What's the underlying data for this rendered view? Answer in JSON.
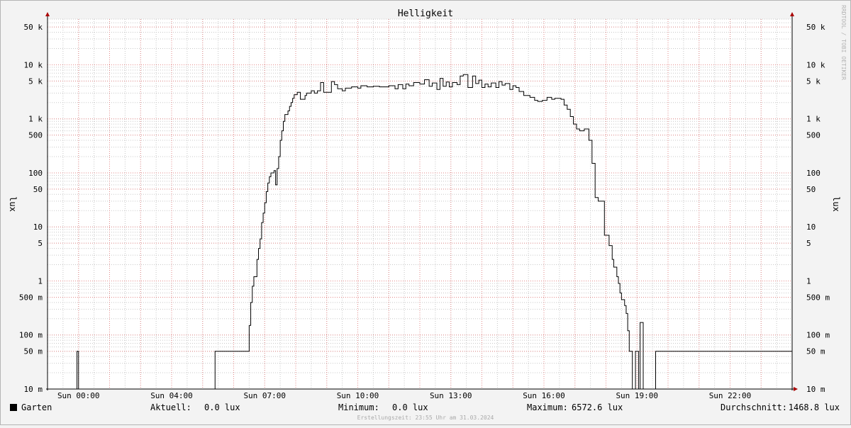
{
  "chart_data": {
    "type": "line",
    "title": "Helligkeit",
    "ylabel": "lux",
    "ylabel_right": "lux",
    "watermark": "RRDTOOL / TOBI OETIKER",
    "yscale": "log",
    "ylim": [
      0.01,
      70000
    ],
    "yticks": [
      {
        "value": 0.01,
        "label": "10 m"
      },
      {
        "value": 0.05,
        "label": "50 m"
      },
      {
        "value": 0.1,
        "label": "100 m"
      },
      {
        "value": 0.5,
        "label": "500 m"
      },
      {
        "value": 1,
        "label": "1"
      },
      {
        "value": 5,
        "label": "5"
      },
      {
        "value": 10,
        "label": "10"
      },
      {
        "value": 50,
        "label": "50"
      },
      {
        "value": 100,
        "label": "100"
      },
      {
        "value": 500,
        "label": "500"
      },
      {
        "value": 1000,
        "label": "1 k"
      },
      {
        "value": 5000,
        "label": "5 k"
      },
      {
        "value": 10000,
        "label": "10 k"
      },
      {
        "value": 50000,
        "label": "50 k"
      }
    ],
    "xunit": "hours of Sun 31.03.2024",
    "xlim": [
      -1,
      23.0
    ],
    "xticks": [
      {
        "value": 0,
        "label": "Sun 00:00"
      },
      {
        "value": 3,
        "label": "Sun 04:00"
      },
      {
        "value": 6,
        "label": "Sun 07:00"
      },
      {
        "value": 9,
        "label": "Sun 10:00"
      },
      {
        "value": 12,
        "label": "Sun 13:00"
      },
      {
        "value": 15,
        "label": "Sun 16:00"
      },
      {
        "value": 18,
        "label": "Sun 19:00"
      },
      {
        "value": 21,
        "label": "Sun 22:00"
      }
    ],
    "series": [
      {
        "name": "Garten",
        "color": "#000000",
        "points": [
          [
            -1.0,
            0.01
          ],
          [
            -0.05,
            0.01
          ],
          [
            -0.05,
            0.05
          ],
          [
            0.0,
            0.05
          ],
          [
            0.0,
            0.01
          ],
          [
            4.4,
            0.01
          ],
          [
            4.4,
            0.05
          ],
          [
            5.5,
            0.05
          ],
          [
            5.5,
            0.15
          ],
          [
            5.55,
            0.15
          ],
          [
            5.55,
            0.4
          ],
          [
            5.6,
            0.4
          ],
          [
            5.6,
            0.8
          ],
          [
            5.65,
            0.8
          ],
          [
            5.65,
            1.2
          ],
          [
            5.75,
            1.2
          ],
          [
            5.75,
            2.5
          ],
          [
            5.8,
            2.5
          ],
          [
            5.8,
            4
          ],
          [
            5.85,
            4
          ],
          [
            5.85,
            6
          ],
          [
            5.9,
            6
          ],
          [
            5.9,
            12
          ],
          [
            5.95,
            12
          ],
          [
            5.95,
            18
          ],
          [
            6.0,
            18
          ],
          [
            6.0,
            28
          ],
          [
            6.05,
            28
          ],
          [
            6.05,
            45
          ],
          [
            6.1,
            45
          ],
          [
            6.1,
            65
          ],
          [
            6.15,
            65
          ],
          [
            6.15,
            85
          ],
          [
            6.2,
            85
          ],
          [
            6.2,
            100
          ],
          [
            6.3,
            100
          ],
          [
            6.3,
            110
          ],
          [
            6.35,
            110
          ],
          [
            6.35,
            60
          ],
          [
            6.4,
            60
          ],
          [
            6.4,
            120
          ],
          [
            6.45,
            120
          ],
          [
            6.45,
            200
          ],
          [
            6.5,
            200
          ],
          [
            6.5,
            400
          ],
          [
            6.55,
            400
          ],
          [
            6.55,
            600
          ],
          [
            6.6,
            600
          ],
          [
            6.6,
            900
          ],
          [
            6.65,
            900
          ],
          [
            6.65,
            1200
          ],
          [
            6.75,
            1200
          ],
          [
            6.75,
            1400
          ],
          [
            6.8,
            1400
          ],
          [
            6.8,
            1700
          ],
          [
            6.85,
            1700
          ],
          [
            6.85,
            2000
          ],
          [
            6.9,
            2000
          ],
          [
            6.9,
            2400
          ],
          [
            6.95,
            2400
          ],
          [
            6.95,
            2800
          ],
          [
            7.05,
            2800
          ],
          [
            7.05,
            3100
          ],
          [
            7.15,
            3100
          ],
          [
            7.15,
            2300
          ],
          [
            7.3,
            2300
          ],
          [
            7.3,
            2700
          ],
          [
            7.35,
            2700
          ],
          [
            7.35,
            3000
          ],
          [
            7.5,
            3000
          ],
          [
            7.5,
            3300
          ],
          [
            7.6,
            3300
          ],
          [
            7.6,
            3000
          ],
          [
            7.7,
            3000
          ],
          [
            7.7,
            3300
          ],
          [
            7.8,
            3300
          ],
          [
            7.8,
            4700
          ],
          [
            7.9,
            4700
          ],
          [
            7.9,
            3100
          ],
          [
            8.15,
            3100
          ],
          [
            8.15,
            4900
          ],
          [
            8.25,
            4900
          ],
          [
            8.25,
            4300
          ],
          [
            8.35,
            4300
          ],
          [
            8.35,
            3600
          ],
          [
            8.5,
            3600
          ],
          [
            8.5,
            3300
          ],
          [
            8.6,
            3300
          ],
          [
            8.6,
            3700
          ],
          [
            8.8,
            3700
          ],
          [
            8.8,
            3900
          ],
          [
            9.0,
            3900
          ],
          [
            9.0,
            3700
          ],
          [
            9.1,
            3700
          ],
          [
            9.1,
            4100
          ],
          [
            9.3,
            4100
          ],
          [
            9.3,
            3900
          ],
          [
            9.5,
            3900
          ],
          [
            9.5,
            4000
          ],
          [
            9.7,
            4000
          ],
          [
            9.7,
            3900
          ],
          [
            10.0,
            3900
          ],
          [
            10.0,
            4100
          ],
          [
            10.2,
            4100
          ],
          [
            10.2,
            3600
          ],
          [
            10.3,
            3600
          ],
          [
            10.3,
            4300
          ],
          [
            10.45,
            4300
          ],
          [
            10.45,
            3600
          ],
          [
            10.55,
            3600
          ],
          [
            10.55,
            4400
          ],
          [
            10.65,
            4400
          ],
          [
            10.65,
            4100
          ],
          [
            10.8,
            4100
          ],
          [
            10.8,
            4700
          ],
          [
            11.0,
            4700
          ],
          [
            11.0,
            4400
          ],
          [
            11.15,
            4400
          ],
          [
            11.15,
            5300
          ],
          [
            11.3,
            5300
          ],
          [
            11.3,
            4000
          ],
          [
            11.4,
            4000
          ],
          [
            11.4,
            4600
          ],
          [
            11.55,
            4600
          ],
          [
            11.55,
            3500
          ],
          [
            11.65,
            3500
          ],
          [
            11.65,
            5600
          ],
          [
            11.75,
            5600
          ],
          [
            11.75,
            4000
          ],
          [
            11.85,
            4000
          ],
          [
            11.85,
            4800
          ],
          [
            11.95,
            4800
          ],
          [
            11.95,
            3900
          ],
          [
            12.05,
            3900
          ],
          [
            12.05,
            4700
          ],
          [
            12.2,
            4700
          ],
          [
            12.2,
            4300
          ],
          [
            12.3,
            4300
          ],
          [
            12.3,
            6200
          ],
          [
            12.4,
            6200
          ],
          [
            12.4,
            6600
          ],
          [
            12.55,
            6600
          ],
          [
            12.55,
            3800
          ],
          [
            12.7,
            3800
          ],
          [
            12.7,
            6200
          ],
          [
            12.8,
            6200
          ],
          [
            12.8,
            4500
          ],
          [
            12.9,
            4500
          ],
          [
            12.9,
            5200
          ],
          [
            13.0,
            5200
          ],
          [
            13.0,
            3800
          ],
          [
            13.1,
            3800
          ],
          [
            13.1,
            4400
          ],
          [
            13.2,
            4400
          ],
          [
            13.2,
            3900
          ],
          [
            13.3,
            3900
          ],
          [
            13.3,
            4600
          ],
          [
            13.45,
            4600
          ],
          [
            13.45,
            3800
          ],
          [
            13.55,
            3800
          ],
          [
            13.55,
            4900
          ],
          [
            13.65,
            4900
          ],
          [
            13.65,
            4200
          ],
          [
            13.75,
            4200
          ],
          [
            13.75,
            4500
          ],
          [
            13.9,
            4500
          ],
          [
            13.9,
            3500
          ],
          [
            14.0,
            3500
          ],
          [
            14.0,
            4100
          ],
          [
            14.1,
            4100
          ],
          [
            14.1,
            3800
          ],
          [
            14.2,
            3800
          ],
          [
            14.2,
            3200
          ],
          [
            14.35,
            3200
          ],
          [
            14.35,
            2700
          ],
          [
            14.55,
            2700
          ],
          [
            14.55,
            2500
          ],
          [
            14.7,
            2500
          ],
          [
            14.7,
            2200
          ],
          [
            14.8,
            2200
          ],
          [
            14.8,
            2100
          ],
          [
            14.95,
            2100
          ],
          [
            14.95,
            2200
          ],
          [
            15.1,
            2200
          ],
          [
            15.1,
            2500
          ],
          [
            15.25,
            2500
          ],
          [
            15.25,
            2300
          ],
          [
            15.35,
            2300
          ],
          [
            15.35,
            2400
          ],
          [
            15.55,
            2400
          ],
          [
            15.55,
            2300
          ],
          [
            15.65,
            2300
          ],
          [
            15.65,
            1800
          ],
          [
            15.75,
            1800
          ],
          [
            15.75,
            1500
          ],
          [
            15.85,
            1500
          ],
          [
            15.85,
            1100
          ],
          [
            15.95,
            1100
          ],
          [
            15.95,
            800
          ],
          [
            16.05,
            800
          ],
          [
            16.05,
            650
          ],
          [
            16.15,
            650
          ],
          [
            16.15,
            600
          ],
          [
            16.3,
            600
          ],
          [
            16.3,
            650
          ],
          [
            16.45,
            650
          ],
          [
            16.45,
            400
          ],
          [
            16.55,
            400
          ],
          [
            16.55,
            150
          ],
          [
            16.65,
            150
          ],
          [
            16.65,
            35
          ],
          [
            16.75,
            35
          ],
          [
            16.75,
            30
          ],
          [
            16.95,
            30
          ],
          [
            16.95,
            7
          ],
          [
            17.1,
            7
          ],
          [
            17.1,
            4.5
          ],
          [
            17.2,
            4.5
          ],
          [
            17.2,
            2.5
          ],
          [
            17.25,
            2.5
          ],
          [
            17.25,
            1.8
          ],
          [
            17.35,
            1.8
          ],
          [
            17.35,
            1.2
          ],
          [
            17.4,
            1.2
          ],
          [
            17.4,
            0.9
          ],
          [
            17.45,
            0.9
          ],
          [
            17.45,
            0.6
          ],
          [
            17.5,
            0.6
          ],
          [
            17.5,
            0.45
          ],
          [
            17.6,
            0.45
          ],
          [
            17.6,
            0.35
          ],
          [
            17.65,
            0.35
          ],
          [
            17.65,
            0.25
          ],
          [
            17.7,
            0.25
          ],
          [
            17.7,
            0.12
          ],
          [
            17.75,
            0.12
          ],
          [
            17.75,
            0.05
          ],
          [
            17.85,
            0.05
          ],
          [
            17.85,
            0.01
          ],
          [
            17.95,
            0.01
          ],
          [
            17.95,
            0.05
          ],
          [
            18.05,
            0.05
          ],
          [
            18.05,
            0.01
          ],
          [
            18.1,
            0.01
          ],
          [
            18.1,
            0.17
          ],
          [
            18.2,
            0.17
          ],
          [
            18.2,
            0.01
          ],
          [
            18.6,
            0.01
          ],
          [
            18.6,
            0.05
          ],
          [
            23.0,
            0.05
          ]
        ]
      }
    ],
    "legend": {
      "name": "Garten",
      "swatch_color": "#000000",
      "current_label": "Aktuell:",
      "current_value": "0.0 lux",
      "min_label": "Minimum:",
      "min_value": "0.0 lux",
      "max_label": "Maximum:",
      "max_value": "6572.6 lux",
      "avg_label": "Durchschnitt:",
      "avg_value": "1468.8 lux"
    },
    "footer": "Erstellungszeit: 23:55 Uhr am 31.03.2024",
    "colors": {
      "background": "#f3f3f3",
      "plot_background": "#ffffff",
      "major_grid": "#e38a8a",
      "minor_grid": "#c8c8c8",
      "axis": "#000000",
      "arrow": "#aa0000",
      "watermark": "#b4b4b4",
      "footer": "#aaaaaa"
    }
  }
}
